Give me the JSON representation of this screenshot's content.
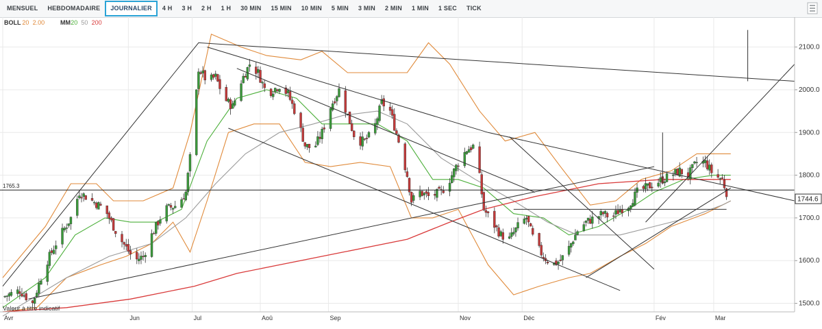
{
  "toolbar": {
    "timeframes": [
      "MENSUEL",
      "HEBDOMADAIRE",
      "JOURNALIER",
      "4 H",
      "3 H",
      "2 H",
      "1 H",
      "30 MIN",
      "15 MIN",
      "10 MIN",
      "5 MIN",
      "3 MIN",
      "2 MIN",
      "1 MIN",
      "1 SEC",
      "TICK"
    ],
    "active": "JOURNALIER"
  },
  "indicators": {
    "boll_name": "BOLL",
    "boll_params": [
      "20",
      "2.00"
    ],
    "ma_name": "MM",
    "ma_params": [
      "20",
      "50",
      "200"
    ]
  },
  "colors": {
    "boll": "#e08a3a",
    "ma20": "#4caf3a",
    "ma50": "#9a9a9a",
    "ma200": "#d93a3a",
    "bull": "#3a9a3a",
    "bear": "#c43a3a",
    "trendline": "#333333",
    "grid": "#e9e9e9",
    "last_price_bg": "#ffffff"
  },
  "disclaimer": "Valeur à titre indicatif",
  "chart_data": {
    "type": "candlestick",
    "title": "",
    "ylim": [
      1480,
      2170
    ],
    "yticks": [
      1500,
      1600,
      1700,
      1800,
      1900,
      2000,
      2100
    ],
    "ytick_labels": [
      "1500.0",
      "1600.0",
      "1700.0",
      "1800.0",
      "1900.0",
      "2000.0",
      "2100.0"
    ],
    "xticks": [
      {
        "day": 0,
        "label": "Avr"
      },
      {
        "day": 59,
        "label": "Jun"
      },
      {
        "day": 89,
        "label": "Jul"
      },
      {
        "day": 121,
        "label": "Aoû"
      },
      {
        "day": 153,
        "label": "Sep"
      },
      {
        "day": 214,
        "label": "Nov"
      },
      {
        "day": 244,
        "label": "Déc"
      },
      {
        "day": 306,
        "label": "Fév"
      },
      {
        "day": 334,
        "label": "Mar"
      }
    ],
    "xlim": [
      0,
      372
    ],
    "grid": true,
    "ref_level": {
      "value": 1765.3,
      "label": "1765.3"
    },
    "last_price": {
      "value": 1744.6,
      "label": "1744.6"
    },
    "close_path": [
      [
        0,
        1515
      ],
      [
        8,
        1530
      ],
      [
        14,
        1500
      ],
      [
        20,
        1590
      ],
      [
        26,
        1650
      ],
      [
        32,
        1700
      ],
      [
        36,
        1760
      ],
      [
        42,
        1740
      ],
      [
        48,
        1720
      ],
      [
        54,
        1660
      ],
      [
        58,
        1630
      ],
      [
        62,
        1600
      ],
      [
        66,
        1610
      ],
      [
        70,
        1660
      ],
      [
        76,
        1720
      ],
      [
        82,
        1730
      ],
      [
        86,
        1760
      ],
      [
        89,
        1880
      ],
      [
        92,
        2050
      ],
      [
        96,
        2020
      ],
      [
        100,
        2030
      ],
      [
        104,
        1980
      ],
      [
        108,
        1960
      ],
      [
        112,
        2020
      ],
      [
        116,
        2060
      ],
      [
        120,
        2040
      ],
      [
        124,
        1990
      ],
      [
        130,
        2010
      ],
      [
        134,
        1990
      ],
      [
        138,
        1940
      ],
      [
        142,
        1870
      ],
      [
        146,
        1860
      ],
      [
        150,
        1900
      ],
      [
        154,
        1960
      ],
      [
        158,
        2000
      ],
      [
        162,
        1940
      ],
      [
        166,
        1880
      ],
      [
        170,
        1880
      ],
      [
        174,
        1900
      ],
      [
        178,
        1970
      ],
      [
        182,
        1950
      ],
      [
        186,
        1880
      ],
      [
        190,
        1800
      ],
      [
        192,
        1740
      ],
      [
        196,
        1760
      ],
      [
        200,
        1750
      ],
      [
        206,
        1760
      ],
      [
        210,
        1790
      ],
      [
        214,
        1830
      ],
      [
        218,
        1860
      ],
      [
        222,
        1870
      ],
      [
        226,
        1720
      ],
      [
        230,
        1690
      ],
      [
        234,
        1660
      ],
      [
        238,
        1650
      ],
      [
        242,
        1680
      ],
      [
        246,
        1700
      ],
      [
        250,
        1640
      ],
      [
        254,
        1610
      ],
      [
        258,
        1590
      ],
      [
        262,
        1600
      ],
      [
        266,
        1630
      ],
      [
        270,
        1670
      ],
      [
        274,
        1690
      ],
      [
        278,
        1700
      ],
      [
        282,
        1710
      ],
      [
        286,
        1700
      ],
      [
        290,
        1720
      ],
      [
        294,
        1730
      ],
      [
        298,
        1760
      ],
      [
        302,
        1770
      ],
      [
        306,
        1780
      ],
      [
        310,
        1790
      ],
      [
        314,
        1800
      ],
      [
        318,
        1810
      ],
      [
        322,
        1800
      ],
      [
        326,
        1830
      ],
      [
        330,
        1830
      ],
      [
        334,
        1800
      ],
      [
        338,
        1790
      ],
      [
        341,
        1745
      ]
    ],
    "series": [
      {
        "name": "BOLL upper",
        "values": [
          [
            0,
            1560
          ],
          [
            20,
            1680
          ],
          [
            32,
            1780
          ],
          [
            44,
            1780
          ],
          [
            52,
            1740
          ],
          [
            58,
            1740
          ],
          [
            66,
            1740
          ],
          [
            80,
            1770
          ],
          [
            88,
            1900
          ],
          [
            98,
            2130
          ],
          [
            112,
            2100
          ],
          [
            124,
            2080
          ],
          [
            140,
            2070
          ],
          [
            150,
            2090
          ],
          [
            162,
            2040
          ],
          [
            176,
            2040
          ],
          [
            190,
            2040
          ],
          [
            200,
            2110
          ],
          [
            210,
            2060
          ],
          [
            224,
            1950
          ],
          [
            236,
            1880
          ],
          [
            250,
            1900
          ],
          [
            262,
            1820
          ],
          [
            276,
            1730
          ],
          [
            288,
            1740
          ],
          [
            300,
            1790
          ],
          [
            314,
            1810
          ],
          [
            326,
            1850
          ],
          [
            342,
            1850
          ]
        ]
      },
      {
        "name": "BOLL lower",
        "values": [
          [
            0,
            1480
          ],
          [
            16,
            1490
          ],
          [
            30,
            1560
          ],
          [
            46,
            1590
          ],
          [
            58,
            1610
          ],
          [
            70,
            1640
          ],
          [
            80,
            1690
          ],
          [
            88,
            1620
          ],
          [
            96,
            1740
          ],
          [
            106,
            1900
          ],
          [
            118,
            1920
          ],
          [
            130,
            1920
          ],
          [
            142,
            1830
          ],
          [
            154,
            1820
          ],
          [
            168,
            1830
          ],
          [
            182,
            1820
          ],
          [
            192,
            1700
          ],
          [
            202,
            1700
          ],
          [
            214,
            1720
          ],
          [
            228,
            1590
          ],
          [
            240,
            1520
          ],
          [
            252,
            1540
          ],
          [
            266,
            1560
          ],
          [
            276,
            1570
          ],
          [
            290,
            1610
          ],
          [
            302,
            1640
          ],
          [
            314,
            1680
          ],
          [
            330,
            1710
          ],
          [
            342,
            1740
          ]
        ]
      },
      {
        "name": "MM 20",
        "values": [
          [
            0,
            1490
          ],
          [
            20,
            1560
          ],
          [
            34,
            1660
          ],
          [
            48,
            1700
          ],
          [
            60,
            1690
          ],
          [
            72,
            1690
          ],
          [
            84,
            1720
          ],
          [
            96,
            1880
          ],
          [
            110,
            1980
          ],
          [
            124,
            2000
          ],
          [
            138,
            1980
          ],
          [
            150,
            1920
          ],
          [
            162,
            1920
          ],
          [
            176,
            1920
          ],
          [
            190,
            1880
          ],
          [
            202,
            1790
          ],
          [
            214,
            1790
          ],
          [
            226,
            1770
          ],
          [
            240,
            1710
          ],
          [
            254,
            1700
          ],
          [
            266,
            1660
          ],
          [
            280,
            1680
          ],
          [
            294,
            1720
          ],
          [
            306,
            1760
          ],
          [
            320,
            1790
          ],
          [
            334,
            1800
          ],
          [
            342,
            1800
          ]
        ]
      },
      {
        "name": "MM 50",
        "values": [
          [
            0,
            1470
          ],
          [
            30,
            1560
          ],
          [
            50,
            1610
          ],
          [
            70,
            1640
          ],
          [
            86,
            1700
          ],
          [
            100,
            1780
          ],
          [
            114,
            1850
          ],
          [
            130,
            1900
          ],
          [
            146,
            1920
          ],
          [
            160,
            1940
          ],
          [
            176,
            1950
          ],
          [
            190,
            1920
          ],
          [
            206,
            1840
          ],
          [
            222,
            1790
          ],
          [
            240,
            1740
          ],
          [
            256,
            1690
          ],
          [
            270,
            1660
          ],
          [
            290,
            1660
          ],
          [
            306,
            1680
          ],
          [
            322,
            1700
          ],
          [
            338,
            1730
          ],
          [
            342,
            1740
          ]
        ]
      },
      {
        "name": "MM 200",
        "values": [
          [
            0,
            1480
          ],
          [
            30,
            1490
          ],
          [
            60,
            1510
          ],
          [
            90,
            1540
          ],
          [
            110,
            1570
          ],
          [
            130,
            1590
          ],
          [
            160,
            1620
          ],
          [
            190,
            1650
          ],
          [
            210,
            1690
          ],
          [
            226,
            1720
          ],
          [
            250,
            1750
          ],
          [
            280,
            1780
          ],
          [
            310,
            1790
          ],
          [
            334,
            1790
          ],
          [
            342,
            1790
          ]
        ]
      }
    ],
    "trendlines": [
      [
        [
          0,
          1540
        ],
        [
          92,
          2110
        ],
        [
          372,
          2020
        ]
      ],
      [
        [
          96,
          2100
        ],
        [
          228,
          1900
        ],
        [
          372,
          1740
        ]
      ],
      [
        [
          106,
          1910
        ],
        [
          290,
          1530
        ]
      ],
      [
        [
          12,
          1510
        ],
        [
          306,
          1820
        ]
      ],
      [
        [
          274,
          1560
        ],
        [
          342,
          1770
        ]
      ],
      [
        [
          302,
          1690
        ],
        [
          372,
          2060
        ]
      ],
      [
        [
          310,
          1780
        ],
        [
          310,
          1900
        ]
      ],
      [
        [
          240,
          1720
        ],
        [
          340,
          1720
        ]
      ],
      [
        [
          238,
          1890
        ],
        [
          306,
          1580
        ]
      ],
      [
        [
          110,
          2050
        ],
        [
          250,
          1760
        ]
      ],
      [
        [
          350,
          2140
        ],
        [
          350,
          2020
        ]
      ]
    ]
  }
}
